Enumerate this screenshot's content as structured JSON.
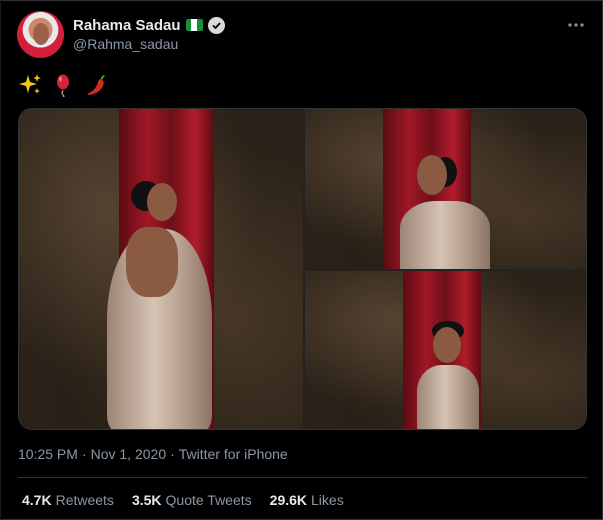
{
  "author": {
    "name": "Rahama Sadau",
    "handle": "@Rahma_sadau",
    "flag": "nigeria-flag-icon",
    "verified": "verified-badge-icon"
  },
  "more_menu": "more-options-icon",
  "tweet": {
    "emojis": [
      "sparkles-emoji-icon",
      "balloon-emoji-icon",
      "hot-pepper-emoji-icon"
    ],
    "media": [
      "photo-1",
      "photo-2",
      "photo-3"
    ]
  },
  "meta": {
    "time": "10:25 PM",
    "sep1": "·",
    "date": "Nov 1, 2020",
    "sep2": "·",
    "source": "Twitter for iPhone"
  },
  "stats": {
    "retweets": {
      "count": "4.7K",
      "label": "Retweets"
    },
    "quotes": {
      "count": "3.5K",
      "label": "Quote Tweets"
    },
    "likes": {
      "count": "29.6K",
      "label": "Likes"
    }
  },
  "colors": {
    "background": "#000000",
    "text_primary": "#e7e9ea",
    "text_secondary": "#8b98a5",
    "divider": "#2f3336",
    "curtain_red": "#a01826"
  }
}
